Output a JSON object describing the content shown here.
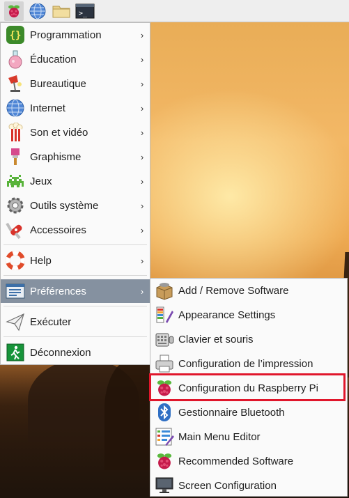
{
  "colors": {
    "menu_bg": "#fafafa",
    "selected_bg": "#8591a0",
    "highlight_border": "#e0162b"
  },
  "panel": {
    "icons": [
      "raspberry-icon",
      "globe-icon",
      "folder-icon",
      "terminal-icon"
    ]
  },
  "menu": {
    "items": [
      {
        "label": "Programmation",
        "icon": "code-braces-icon",
        "has_submenu": true
      },
      {
        "label": "Éducation",
        "icon": "flask-icon",
        "has_submenu": true
      },
      {
        "label": "Bureautique",
        "icon": "desk-lamp-icon",
        "has_submenu": true
      },
      {
        "label": "Internet",
        "icon": "globe-icon",
        "has_submenu": true
      },
      {
        "label": "Son et vidéo",
        "icon": "popcorn-icon",
        "has_submenu": true
      },
      {
        "label": "Graphisme",
        "icon": "paintbrush-icon",
        "has_submenu": true
      },
      {
        "label": "Jeux",
        "icon": "space-invader-icon",
        "has_submenu": true
      },
      {
        "label": "Outils système",
        "icon": "gear-icon",
        "has_submenu": true
      },
      {
        "label": "Accessoires",
        "icon": "swiss-knife-icon",
        "has_submenu": true
      },
      {
        "label": "Help",
        "icon": "lifebuoy-icon",
        "has_submenu": true
      },
      {
        "label": "Préférences",
        "icon": "preferences-icon",
        "has_submenu": true,
        "selected": true
      },
      {
        "label": "Exécuter",
        "icon": "paper-plane-icon",
        "has_submenu": false
      },
      {
        "label": "Déconnexion",
        "icon": "exit-icon",
        "has_submenu": false
      }
    ],
    "arrow": "›"
  },
  "submenu": {
    "items": [
      {
        "label": "Add / Remove Software",
        "icon": "package-icon"
      },
      {
        "label": "Appearance Settings",
        "icon": "palette-icon"
      },
      {
        "label": "Clavier et souris",
        "icon": "keyboard-mouse-icon"
      },
      {
        "label": "Configuration de l’impression",
        "icon": "printer-icon"
      },
      {
        "label": "Configuration du Raspberry Pi",
        "icon": "raspberry-icon",
        "highlighted": true
      },
      {
        "label": "Gestionnaire Bluetooth",
        "icon": "bluetooth-icon"
      },
      {
        "label": "Main Menu Editor",
        "icon": "menu-editor-icon"
      },
      {
        "label": "Recommended Software",
        "icon": "raspberry-icon"
      },
      {
        "label": "Screen Configuration",
        "icon": "monitor-icon"
      }
    ]
  }
}
